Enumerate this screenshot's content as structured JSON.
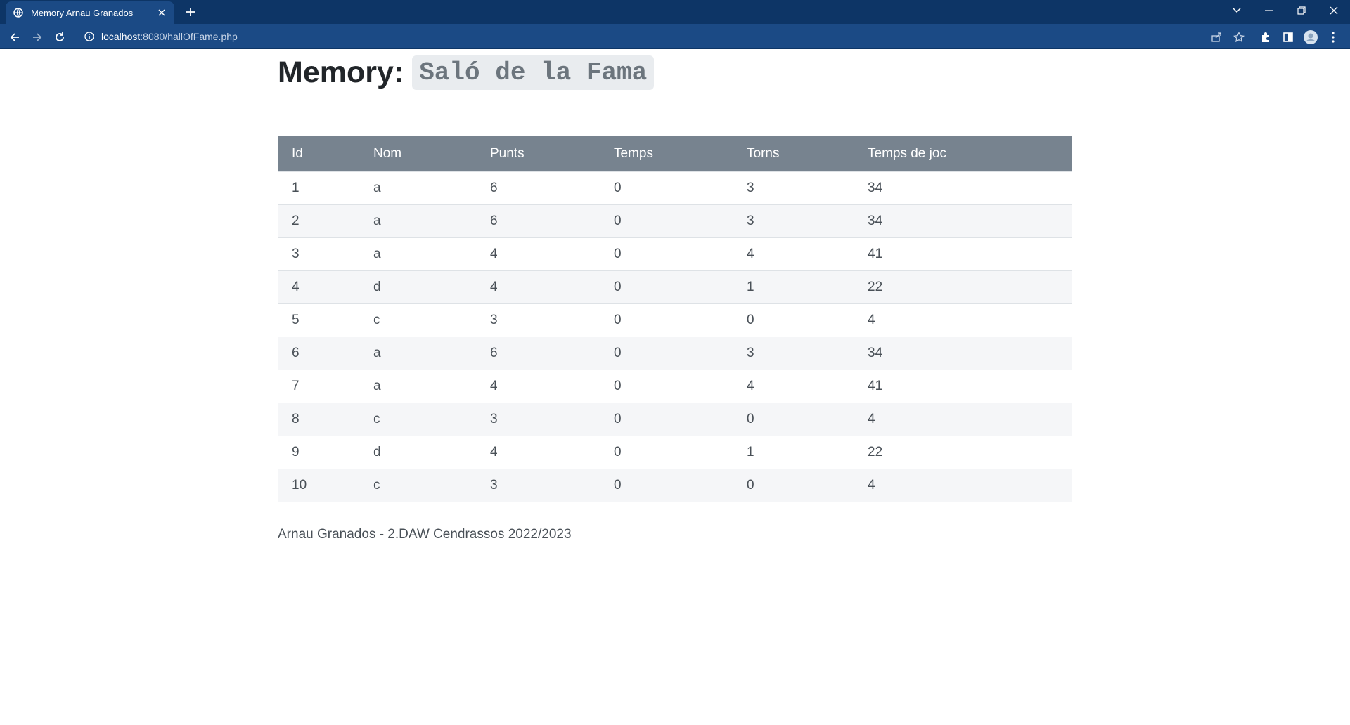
{
  "browser": {
    "tab_title": "Memory Arnau Granados",
    "url_host": "localhost",
    "url_rest": ":8080/hallOfFame.php"
  },
  "page": {
    "heading_main": "Memory:",
    "heading_code": "Saló de la Fama",
    "footer": "Arnau Granados - 2.DAW Cendrassos 2022/2023"
  },
  "table": {
    "headers": [
      "Id",
      "Nom",
      "Punts",
      "Temps",
      "Torns",
      "Temps de joc"
    ],
    "rows": [
      [
        "1",
        "a",
        "6",
        "0",
        "3",
        "34"
      ],
      [
        "2",
        "a",
        "6",
        "0",
        "3",
        "34"
      ],
      [
        "3",
        "a",
        "4",
        "0",
        "4",
        "41"
      ],
      [
        "4",
        "d",
        "4",
        "0",
        "1",
        "22"
      ],
      [
        "5",
        "c",
        "3",
        "0",
        "0",
        "4"
      ],
      [
        "6",
        "a",
        "6",
        "0",
        "3",
        "34"
      ],
      [
        "7",
        "a",
        "4",
        "0",
        "4",
        "41"
      ],
      [
        "8",
        "c",
        "3",
        "0",
        "0",
        "4"
      ],
      [
        "9",
        "d",
        "4",
        "0",
        "1",
        "22"
      ],
      [
        "10",
        "c",
        "3",
        "0",
        "0",
        "4"
      ]
    ]
  },
  "colors": {
    "tabbar": "#0d3566",
    "toolbar": "#1b4a85",
    "table_header": "#77838f",
    "row_stripe": "#f5f6f8"
  }
}
